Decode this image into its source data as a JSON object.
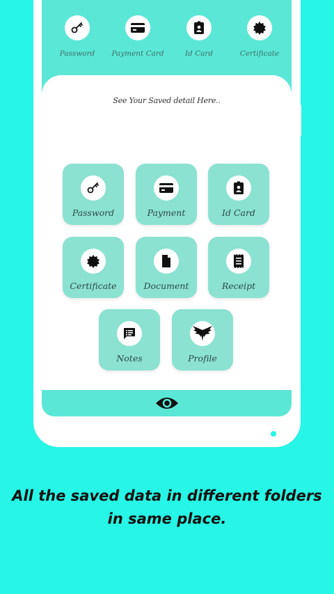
{
  "top_bar": {
    "items": [
      {
        "label": "Password",
        "icon": "key-icon"
      },
      {
        "label": "Payment Card",
        "icon": "card-icon"
      },
      {
        "label": "Id Card",
        "icon": "id-card-icon"
      },
      {
        "label": "Certificate",
        "icon": "badge-icon"
      }
    ]
  },
  "main": {
    "subtitle": "See Your Saved detail Here..",
    "tiles": [
      {
        "label": "Password",
        "icon": "key-icon"
      },
      {
        "label": "Payment",
        "icon": "card-icon"
      },
      {
        "label": "Id Card",
        "icon": "id-card-icon"
      },
      {
        "label": "Certificate",
        "icon": "badge-icon"
      },
      {
        "label": "Document",
        "icon": "document-icon"
      },
      {
        "label": "Receipt",
        "icon": "receipt-icon"
      },
      {
        "label": "Notes",
        "icon": "notes-icon"
      },
      {
        "label": "Profile",
        "icon": "wings-logo-icon"
      }
    ]
  },
  "bottom_bar": {
    "icon": "eye-icon"
  },
  "caption": {
    "line1": "All the saved data in different folders",
    "line2": "in same place."
  },
  "colors": {
    "background": "#27f5e6",
    "accent": "#5be7d6",
    "tile": "#8be2d1"
  }
}
